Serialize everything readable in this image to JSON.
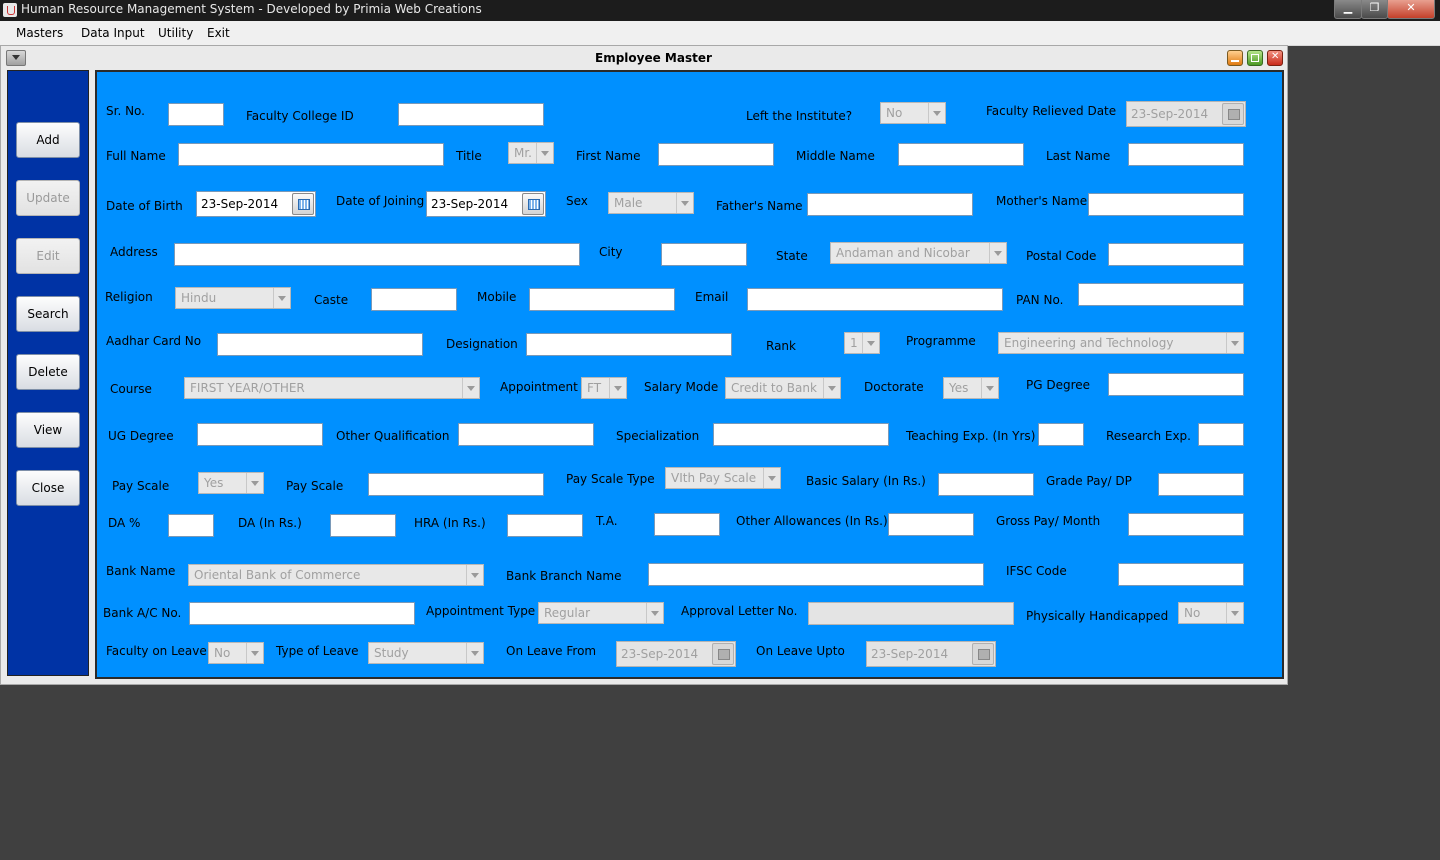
{
  "os": {
    "title": "Human Resource Management System - Developed by Primia Web Creations"
  },
  "menu": [
    "Masters",
    "Data Input",
    "Utility",
    "Exit"
  ],
  "window": {
    "title": "Employee Master"
  },
  "sidebar": {
    "add": "Add",
    "update": "Update",
    "edit": "Edit",
    "search": "Search",
    "delete": "Delete",
    "view": "View",
    "close": "Close"
  },
  "form": {
    "sr_no": {
      "label": "Sr. No.",
      "value": ""
    },
    "faculty_college_id": {
      "label": "Faculty College ID",
      "value": ""
    },
    "left_institute": {
      "label": "Left the Institute?",
      "value": "No"
    },
    "faculty_relieved_date": {
      "label": "Faculty Relieved Date",
      "value": "23-Sep-2014"
    },
    "full_name": {
      "label": "Full Name",
      "value": ""
    },
    "title": {
      "label": "Title",
      "value": "Mr."
    },
    "first_name": {
      "label": "First Name",
      "value": ""
    },
    "middle_name": {
      "label": "Middle Name",
      "value": ""
    },
    "last_name": {
      "label": "Last Name",
      "value": ""
    },
    "date_of_birth": {
      "label": "Date of Birth",
      "value": "23-Sep-2014"
    },
    "date_of_joining": {
      "label": "Date of Joining",
      "value": "23-Sep-2014"
    },
    "sex": {
      "label": "Sex",
      "value": "Male"
    },
    "fathers_name": {
      "label": "Father's Name",
      "value": ""
    },
    "mothers_name": {
      "label": "Mother's Name",
      "value": ""
    },
    "address": {
      "label": "Address",
      "value": ""
    },
    "city": {
      "label": "City",
      "value": ""
    },
    "state": {
      "label": "State",
      "value": "Andaman and Nicobar"
    },
    "postal_code": {
      "label": "Postal Code",
      "value": ""
    },
    "religion": {
      "label": "Religion",
      "value": "Hindu"
    },
    "caste": {
      "label": "Caste",
      "value": ""
    },
    "mobile": {
      "label": "Mobile",
      "value": ""
    },
    "email": {
      "label": "Email",
      "value": ""
    },
    "pan_no": {
      "label": "PAN No.",
      "value": ""
    },
    "aadhar_card_no": {
      "label": "Aadhar Card No",
      "value": ""
    },
    "designation": {
      "label": "Designation",
      "value": ""
    },
    "rank": {
      "label": "Rank",
      "value": "1"
    },
    "programme": {
      "label": "Programme",
      "value": "Engineering and Technology"
    },
    "course": {
      "label": "Course",
      "value": "FIRST YEAR/OTHER"
    },
    "appointment": {
      "label": "Appointment",
      "value": "FT"
    },
    "salary_mode": {
      "label": "Salary Mode",
      "value": "Credit to Bank"
    },
    "doctorate": {
      "label": "Doctorate",
      "value": "Yes"
    },
    "pg_degree": {
      "label": "PG Degree",
      "value": ""
    },
    "ug_degree": {
      "label": "UG Degree",
      "value": ""
    },
    "other_qualification": {
      "label": "Other Qualification",
      "value": ""
    },
    "specialization": {
      "label": "Specialization",
      "value": ""
    },
    "teaching_exp": {
      "label": "Teaching Exp. (In Yrs)",
      "value": ""
    },
    "research_exp": {
      "label": "Research Exp.",
      "value": ""
    },
    "pay_scale_flag": {
      "label": "Pay Scale",
      "value": "Yes"
    },
    "pay_scale": {
      "label": "Pay Scale",
      "value": ""
    },
    "pay_scale_type": {
      "label": "Pay Scale Type",
      "value": "VIth Pay Scale"
    },
    "basic_salary": {
      "label": "Basic Salary (In Rs.)",
      "value": ""
    },
    "grade_pay": {
      "label": "Grade Pay/ DP",
      "value": ""
    },
    "da_percent": {
      "label": "DA %",
      "value": ""
    },
    "da_rs": {
      "label": "DA (In Rs.)",
      "value": ""
    },
    "hra_rs": {
      "label": "HRA (In Rs.)",
      "value": ""
    },
    "ta": {
      "label": "T.A.",
      "value": ""
    },
    "other_allowances": {
      "label": "Other Allowances (In Rs.)",
      "value": ""
    },
    "gross_pay": {
      "label": "Gross Pay/ Month",
      "value": ""
    },
    "bank_name": {
      "label": "Bank Name",
      "value": "Oriental Bank of Commerce"
    },
    "bank_branch_name": {
      "label": "Bank Branch Name",
      "value": ""
    },
    "ifsc_code": {
      "label": "IFSC Code",
      "value": ""
    },
    "bank_ac_no": {
      "label": "Bank A/C No.",
      "value": ""
    },
    "appointment_type": {
      "label": "Appointment Type",
      "value": "Regular"
    },
    "approval_letter_no": {
      "label": "Approval Letter No.",
      "value": ""
    },
    "physically_handicapped": {
      "label": "Physically Handicapped",
      "value": "No"
    },
    "faculty_on_leave": {
      "label": "Faculty on Leave",
      "value": "No"
    },
    "type_of_leave": {
      "label": "Type of Leave",
      "value": "Study"
    },
    "on_leave_from": {
      "label": "On Leave From",
      "value": "23-Sep-2014"
    },
    "on_leave_upto": {
      "label": "On Leave Upto",
      "value": "23-Sep-2014"
    }
  }
}
